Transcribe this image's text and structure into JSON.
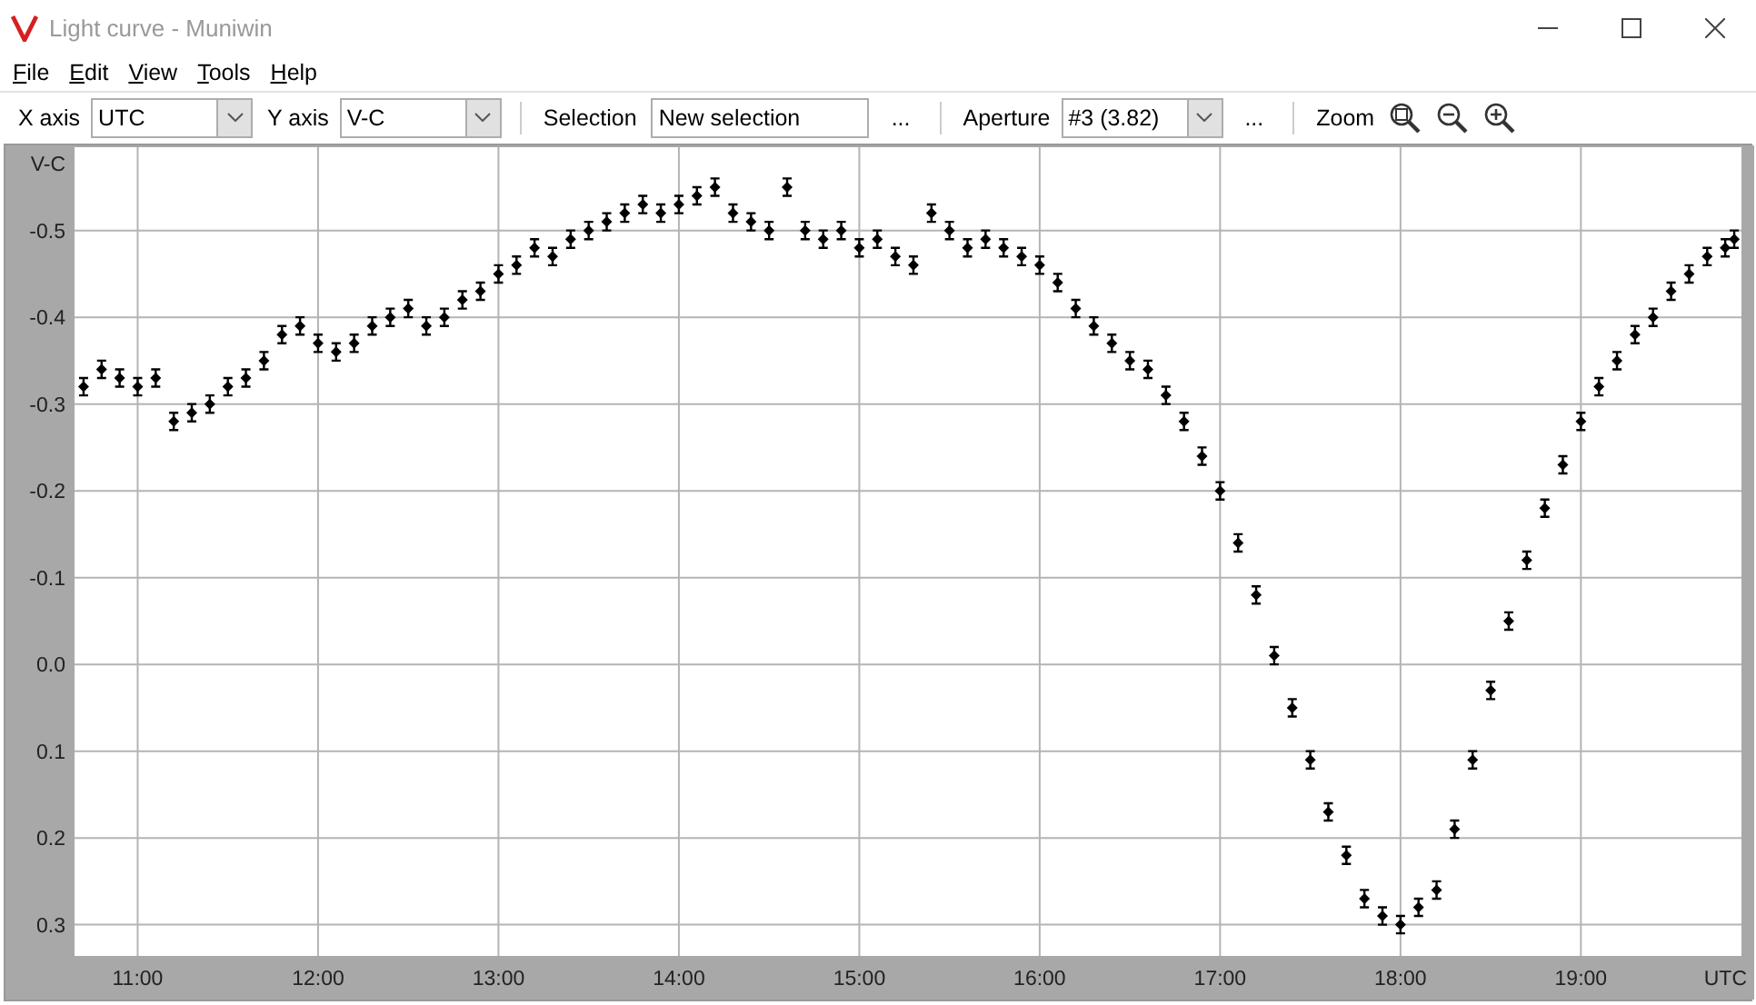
{
  "window": {
    "title": "Light curve - Muniwin"
  },
  "menu": [
    {
      "label": "File"
    },
    {
      "label": "Edit"
    },
    {
      "label": "View"
    },
    {
      "label": "Tools"
    },
    {
      "label": "Help"
    }
  ],
  "toolbar": [
    {
      "kind": "label",
      "text": "X axis"
    },
    {
      "kind": "combo",
      "value": "UTC"
    },
    {
      "kind": "label",
      "text": "Y axis"
    },
    {
      "kind": "combo",
      "value": "V-C"
    },
    {
      "kind": "separator"
    },
    {
      "kind": "label",
      "text": "Selection"
    },
    {
      "kind": "field",
      "value": "New selection"
    },
    {
      "kind": "button",
      "text": "..."
    },
    {
      "kind": "separator"
    },
    {
      "kind": "label",
      "text": "Aperture"
    },
    {
      "kind": "combo",
      "value": "#3 (3.82)"
    },
    {
      "kind": "button",
      "text": "..."
    },
    {
      "kind": "separator"
    },
    {
      "kind": "label",
      "text": "Zoom"
    },
    {
      "kind": "zoom_fit"
    },
    {
      "kind": "zoom_out"
    },
    {
      "kind": "zoom_in"
    }
  ],
  "chart": {
    "chart_data": {
      "type": "scatter",
      "xlabel": "UTC",
      "ylabel": "V-C",
      "grid": true,
      "xlim": [
        10.65,
        19.89
      ],
      "ylim": [
        0.336,
        -0.596
      ],
      "xticks": [
        {
          "value": 11,
          "label": "11:00"
        },
        {
          "value": 12,
          "label": "12:00"
        },
        {
          "value": 13,
          "label": "13:00"
        },
        {
          "value": 14,
          "label": "14:00"
        },
        {
          "value": 15,
          "label": "15:00"
        },
        {
          "value": 16,
          "label": "16:00"
        },
        {
          "value": 17,
          "label": "17:00"
        },
        {
          "value": 18,
          "label": "18:00"
        },
        {
          "value": 19,
          "label": "19:00"
        }
      ],
      "yticks": [
        {
          "value": -0.5,
          "label": "-0.5"
        },
        {
          "value": -0.4,
          "label": "-0.4"
        },
        {
          "value": -0.3,
          "label": "-0.3"
        },
        {
          "value": -0.2,
          "label": "-0.2"
        },
        {
          "value": -0.1,
          "label": "-0.1"
        },
        {
          "value": 0,
          "label": "0.0"
        },
        {
          "value": 0.1,
          "label": "0.1"
        },
        {
          "value": 0.2,
          "label": "0.2"
        },
        {
          "value": 0.3,
          "label": "0.3"
        }
      ],
      "x": [
        10.7,
        10.8,
        10.9,
        11.0,
        11.1,
        11.2,
        11.3,
        11.4,
        11.5,
        11.6,
        11.7,
        11.8,
        11.9,
        12.0,
        12.1,
        12.2,
        12.3,
        12.4,
        12.5,
        12.6,
        12.7,
        12.8,
        12.9,
        13.0,
        13.1,
        13.2,
        13.3,
        13.4,
        13.5,
        13.6,
        13.7,
        13.8,
        13.9,
        14.0,
        14.1,
        14.2,
        14.3,
        14.4,
        14.5,
        14.6,
        14.7,
        14.8,
        14.9,
        15.0,
        15.1,
        15.2,
        15.3,
        15.4,
        15.5,
        15.6,
        15.7,
        15.8,
        15.9,
        16.0,
        16.1,
        16.2,
        16.3,
        16.4,
        16.5,
        16.6,
        16.7,
        16.8,
        16.9,
        17.0,
        17.1,
        17.2,
        17.3,
        17.4,
        17.5,
        17.6,
        17.7,
        17.8,
        17.9,
        18.0,
        18.1,
        18.2,
        18.3,
        18.4,
        18.5,
        18.6,
        18.7,
        18.8,
        18.9,
        19.0,
        19.1,
        19.2,
        19.3,
        19.4,
        19.5,
        19.6,
        19.7,
        19.8,
        19.85
      ],
      "series": [
        {
          "values": [
            -0.32,
            -0.34,
            -0.33,
            -0.32,
            -0.33,
            -0.28,
            -0.29,
            -0.3,
            -0.32,
            -0.33,
            -0.35,
            -0.38,
            -0.39,
            -0.37,
            -0.36,
            -0.37,
            -0.39,
            -0.4,
            -0.41,
            -0.39,
            -0.4,
            -0.42,
            -0.43,
            -0.45,
            -0.46,
            -0.48,
            -0.47,
            -0.49,
            -0.5,
            -0.51,
            -0.52,
            -0.53,
            -0.52,
            -0.53,
            -0.54,
            -0.55,
            -0.52,
            -0.51,
            -0.5,
            -0.55,
            -0.5,
            -0.49,
            -0.5,
            -0.48,
            -0.49,
            -0.47,
            -0.46,
            -0.52,
            -0.5,
            -0.48,
            -0.49,
            -0.48,
            -0.47,
            -0.46,
            -0.44,
            -0.41,
            -0.39,
            -0.37,
            -0.35,
            -0.34,
            -0.31,
            -0.28,
            -0.24,
            -0.2,
            -0.14,
            -0.08,
            -0.01,
            0.05,
            0.11,
            0.17,
            0.22,
            0.27,
            0.29,
            0.3,
            0.28,
            0.26,
            0.19,
            0.11,
            0.03,
            -0.05,
            -0.12,
            -0.18,
            -0.23,
            -0.28,
            -0.32,
            -0.35,
            -0.38,
            -0.4,
            -0.43,
            -0.45,
            -0.47,
            -0.48,
            -0.49
          ],
          "errors": [
            0.01,
            0.01,
            0.01,
            0.01,
            0.01,
            0.01,
            0.01,
            0.01,
            0.01,
            0.01,
            0.01,
            0.01,
            0.01,
            0.01,
            0.01,
            0.01,
            0.01,
            0.01,
            0.01,
            0.01,
            0.01,
            0.01,
            0.01,
            0.01,
            0.01,
            0.01,
            0.01,
            0.01,
            0.01,
            0.01,
            0.01,
            0.01,
            0.01,
            0.01,
            0.01,
            0.01,
            0.01,
            0.01,
            0.01,
            0.01,
            0.01,
            0.01,
            0.01,
            0.01,
            0.01,
            0.01,
            0.01,
            0.01,
            0.01,
            0.01,
            0.01,
            0.01,
            0.01,
            0.01,
            0.01,
            0.01,
            0.01,
            0.01,
            0.01,
            0.01,
            0.01,
            0.01,
            0.01,
            0.01,
            0.01,
            0.01,
            0.01,
            0.01,
            0.01,
            0.01,
            0.01,
            0.01,
            0.01,
            0.01,
            0.01,
            0.01,
            0.01,
            0.01,
            0.01,
            0.01,
            0.01,
            0.01,
            0.01,
            0.01,
            0.01,
            0.01,
            0.01,
            0.01,
            0.01,
            0.01,
            0.01,
            0.01,
            0.01
          ]
        }
      ]
    }
  }
}
